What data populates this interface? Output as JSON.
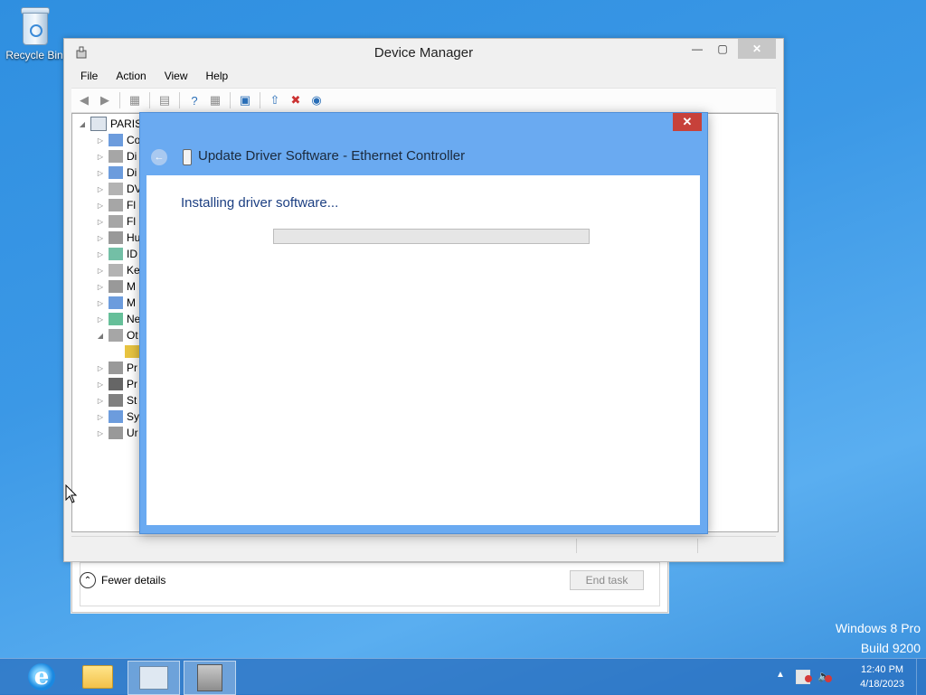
{
  "desktop": {
    "recycle_bin_label": "Recycle Bin",
    "watermark_line1": "Windows 8 Pro",
    "watermark_line2": "Build 9200"
  },
  "device_manager": {
    "title": "Device Manager",
    "menu": [
      "File",
      "Action",
      "View",
      "Help"
    ],
    "tree_root": "PARIS",
    "tree_items": [
      "Co",
      "Di",
      "Di",
      "DV",
      "Fl",
      "Fl",
      "Hu",
      "ID",
      "Ke",
      "M",
      "M",
      "Ne",
      "Ot",
      "",
      "Pr",
      "Pr",
      "St",
      "Sy",
      "Ur"
    ]
  },
  "update_dialog": {
    "title": "Update Driver Software - Ethernet Controller",
    "heading": "Installing driver software...",
    "progress": 0
  },
  "task_manager": {
    "fewer_details": "Fewer details",
    "end_task": "End task"
  },
  "taskbar": {
    "time": "12:40 PM",
    "date": "4/18/2023"
  }
}
